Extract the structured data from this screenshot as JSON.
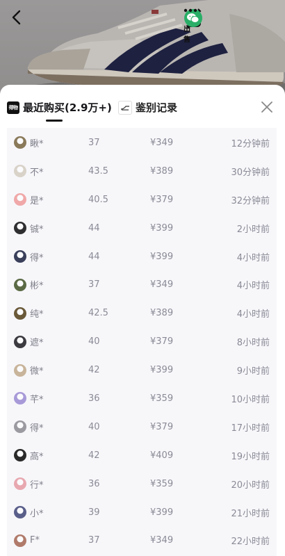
{
  "topbar": {
    "back_icon": "chevron-left-icon",
    "sell_label": "出售",
    "wechat_icon": "wechat-icon",
    "more_icon": "more-dots-icon"
  },
  "sheet": {
    "tabs": [
      {
        "icon_text": "得物",
        "label": "最近购买(2.9万+)",
        "active": true
      },
      {
        "icon_text": "",
        "label": "鉴别记录",
        "active": false
      }
    ],
    "close_icon": "close-icon"
  },
  "colors": {
    "accent": "#111111",
    "list_bg": "#f7f7fa",
    "row_text": "#8a8a96"
  },
  "records": [
    {
      "name": "瞅*",
      "size": "37",
      "price": "¥349",
      "time": "12分钟前",
      "avatar_color": "#8a7a5a"
    },
    {
      "name": "不*",
      "size": "43.5",
      "price": "¥389",
      "time": "30分钟前",
      "avatar_color": "#d8d2c8"
    },
    {
      "name": "是*",
      "size": "40.5",
      "price": "¥379",
      "time": "32分钟前",
      "avatar_color": "#f0a8a8"
    },
    {
      "name": "铖*",
      "size": "44",
      "price": "¥399",
      "time": "2小时前",
      "avatar_color": "#2e2e30"
    },
    {
      "name": "得*",
      "size": "44",
      "price": "¥399",
      "time": "4小时前",
      "avatar_color": "#3a3f5a"
    },
    {
      "name": "彬*",
      "size": "37",
      "price": "¥349",
      "time": "4小时前",
      "avatar_color": "#5b6a45"
    },
    {
      "name": "纯*",
      "size": "42.5",
      "price": "¥389",
      "time": "4小时前",
      "avatar_color": "#6b5a3a"
    },
    {
      "name": "遮*",
      "size": "40",
      "price": "¥379",
      "time": "8小时前",
      "avatar_color": "#3b3b40"
    },
    {
      "name": "微*",
      "size": "42",
      "price": "¥399",
      "time": "9小时前",
      "avatar_color": "#c8b49a"
    },
    {
      "name": "芊*",
      "size": "36",
      "price": "¥359",
      "time": "10小时前",
      "avatar_color": "#a89ad8"
    },
    {
      "name": "得*",
      "size": "40",
      "price": "¥379",
      "time": "17小时前",
      "avatar_color": "#9a9aa0"
    },
    {
      "name": "高*",
      "size": "42",
      "price": "¥409",
      "time": "19小时前",
      "avatar_color": "#2a2a2a"
    },
    {
      "name": "行*",
      "size": "36",
      "price": "¥359",
      "time": "20小时前",
      "avatar_color": "#e8a8b0"
    },
    {
      "name": "小*",
      "size": "39",
      "price": "¥399",
      "time": "21小时前",
      "avatar_color": "#5a5f8a"
    },
    {
      "name": "F*",
      "size": "37",
      "price": "¥349",
      "time": "22小时前",
      "avatar_color": "#b07a6a"
    }
  ]
}
